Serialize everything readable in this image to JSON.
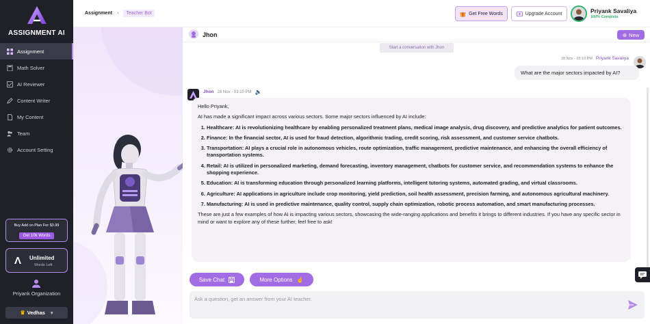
{
  "brand": {
    "name": "ASSIGNMENT AI"
  },
  "sidebar": {
    "items": [
      {
        "label": "Assignment",
        "icon": "grid-icon",
        "active": true
      },
      {
        "label": "Math Solver",
        "icon": "calculator-icon"
      },
      {
        "label": "AI Reviewer",
        "icon": "review-icon"
      },
      {
        "label": "Content Writer",
        "icon": "writer-icon"
      },
      {
        "label": "My Content",
        "icon": "document-icon"
      },
      {
        "label": "Team",
        "icon": "team-icon"
      },
      {
        "label": "Account Setting",
        "icon": "gear-icon"
      }
    ],
    "promo": {
      "title": "Buy Add on Plan For $3.99",
      "button": "Get 10k Words"
    },
    "plan": {
      "title": "Unlimited",
      "subtitle": "Words Left"
    },
    "organization": "Priyank Organization",
    "workspace": "Vedhas"
  },
  "header": {
    "breadcrumb": [
      "Assignment",
      "Teacher Bot"
    ],
    "free_words": "Get Free Words",
    "upgrade": "Upgrade Account",
    "user_name": "Priyank Savaliya",
    "user_status": "100% Complete"
  },
  "chat": {
    "bot_name": "Jhon",
    "new_label": "New",
    "start_note": "Start a conversation with Jhon",
    "user_message": {
      "time": "28 Nov - 03:10 PM",
      "name": "Priyank Savaliya",
      "text": "What are the major sectors impacted by AI?"
    },
    "bot_message": {
      "time": "28 Nov - 03:10 PM",
      "name": "Jhon",
      "greeting": "Hello Priyank,",
      "intro": "AI has made a significant impact across various sectors. Some major sectors influenced by AI include:",
      "points": [
        "Healthcare: AI is revolutionizing healthcare by enabling personalized treatment plans, medical image analysis, drug discovery, and predictive analytics for patient outcomes.",
        "Finance: In the financial sector, AI is used for fraud detection, algorithmic trading, credit scoring, risk assessment, and customer service chatbots.",
        "Transportation: AI plays a crucial role in autonomous vehicles, route optimization, traffic management, predictive maintenance, and enhancing the overall efficiency of transportation systems.",
        "Retail: AI is utilized in personalized marketing, demand forecasting, inventory management, chatbots for customer service, and recommendation systems to enhance the shopping experience.",
        "Education: AI is transforming education through personalized learning platforms, intelligent tutoring systems, automated grading, and virtual classrooms.",
        "Agriculture: AI applications in agriculture include crop monitoring, yield prediction, soil health assessment, precision farming, and autonomous agricultural machinery.",
        "Manufacturing: AI is used in predictive maintenance, quality control, supply chain optimization, robotic process automation, and smart manufacturing processes."
      ],
      "outro": "These are just a few examples of how AI is impacting various sectors, showcasing the wide-ranging applications and benefits it brings to different industries. If you have any specific sector in mind or want to explore any of these further, feel free to ask!"
    },
    "save_chat": "Save Chat",
    "more_options": "More Options",
    "input_placeholder": "Ask a question, get an answer from your AI teacher."
  },
  "colors": {
    "accent": "#a26de4",
    "sidebar_bg": "#1f2028",
    "success": "#2fb36d"
  }
}
